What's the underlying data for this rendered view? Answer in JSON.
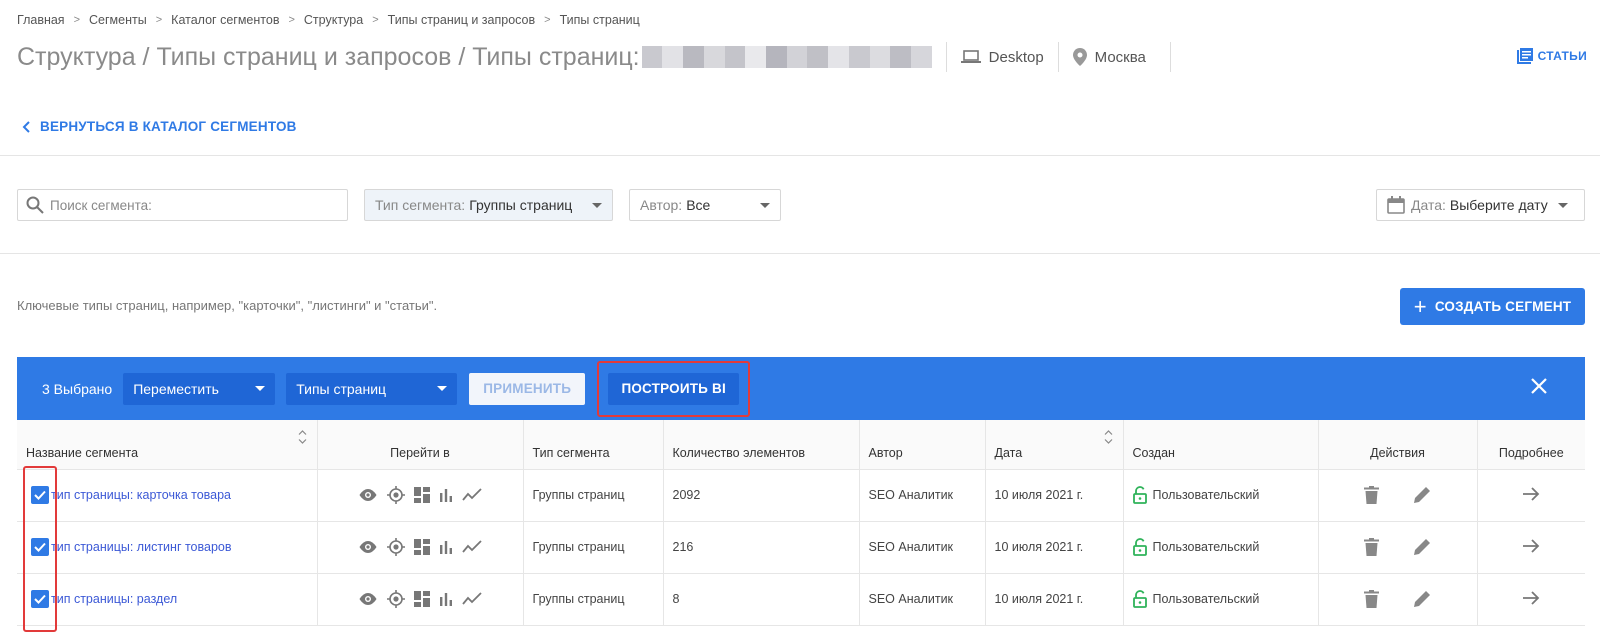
{
  "breadcrumb": [
    "Главная",
    "Сегменты",
    "Каталог сегментов",
    "Структура",
    "Типы страниц и запросов",
    "Типы страниц"
  ],
  "header": {
    "title": "Структура / Типы страниц и запросов / Типы страниц:",
    "device": "Desktop",
    "region": "Москва",
    "articles_label": "СТАТЬИ"
  },
  "back_label": "ВЕРНУТЬСЯ В КАТАЛОГ СЕГМЕНТОВ",
  "filters": {
    "search_placeholder": "Поиск сегмента:",
    "type_label": "Тип сегмента:",
    "type_value": "Группы страниц",
    "author_label": "Автор:",
    "author_value": "Все",
    "date_label": "Дата:",
    "date_value": "Выберите дату"
  },
  "hint": "Ключевые типы страниц, например, \"карточки\", \"листинги\" и \"статьи\".",
  "create_label": "СОЗДАТЬ СЕГМЕНТ",
  "action_bar": {
    "selected": "3 Выбрано",
    "action": "Переместить",
    "target": "Типы страниц",
    "apply": "ПРИМЕНИТЬ",
    "build": "ПОСТРОИТЬ BI"
  },
  "table": {
    "columns": [
      "Название сегмента",
      "Перейти в",
      "Тип сегмента",
      "Количество элементов",
      "Автор",
      "Дата",
      "Создан",
      "Действия",
      "Подробнее"
    ],
    "rows": [
      {
        "name": "тип страницы: карточка товара",
        "type": "Группы страниц",
        "count": "2092",
        "author": "SEO Аналитик",
        "date": "10 июля 2021 г.",
        "created": "Пользовательский"
      },
      {
        "name": "тип страницы: листинг товаров",
        "type": "Группы страниц",
        "count": "216",
        "author": "SEO Аналитик",
        "date": "10 июля 2021 г.",
        "created": "Пользовательский"
      },
      {
        "name": "тип страницы: раздел",
        "type": "Группы страниц",
        "count": "8",
        "author": "SEO Аналитик",
        "date": "10 июля 2021 г.",
        "created": "Пользовательский"
      }
    ]
  },
  "colors": {
    "accent": "#2f7ae5",
    "highlight": "#e23a3a",
    "lock": "#2fb35a"
  }
}
